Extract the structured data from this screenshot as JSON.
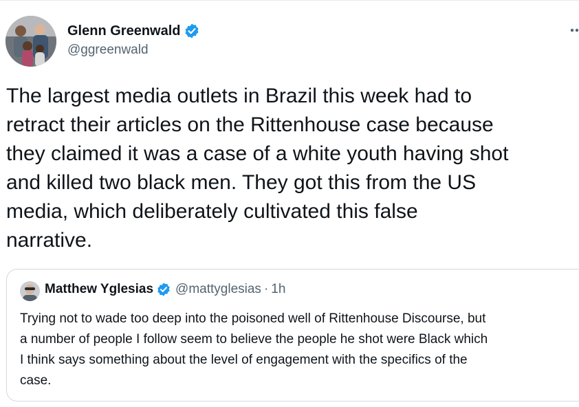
{
  "tweet": {
    "author": {
      "name": "Glenn Greenwald",
      "handle": "@ggreenwald",
      "verified": true,
      "avatar_icon": "family-photo-avatar"
    },
    "more_icon": "more-dots-icon",
    "text_lines": [
      "The largest media outlets in Brazil this week had to",
      "retract their articles on the Rittenhouse case because",
      "they claimed it was a case of a white youth having shot",
      "and killed two black men. They got this from the US",
      "media, which deliberately cultivated this false",
      "narrative."
    ]
  },
  "quoted_tweet": {
    "author": {
      "name": "Matthew Yglesias",
      "handle": "@mattyglesias",
      "separator": "·",
      "time": "1h",
      "verified": true,
      "avatar_icon": "profile-photo-avatar"
    },
    "text_lines": [
      "Trying not to wade too deep into the poisoned well of Rittenhouse Discourse, but",
      "a number of people I follow seem to believe the people he shot were Black which",
      "I think says something about the level of engagement with the specifics of the",
      "case."
    ]
  },
  "colors": {
    "text": "#0f1419",
    "secondary": "#536471",
    "verified_blue": "#1d9bf0",
    "border": "#cfd9de"
  }
}
